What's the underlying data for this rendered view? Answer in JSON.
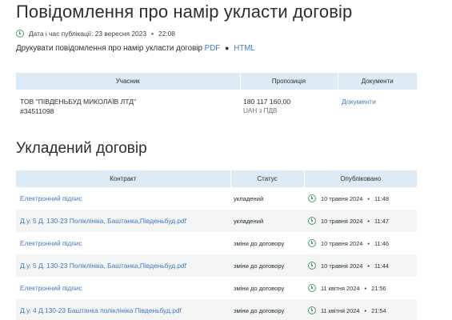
{
  "notice": {
    "title": "Повідомлення про намір укласти договір",
    "pub_label": "Дата і час публікації: 23 вересня 2023",
    "pub_time": "22:08",
    "print_label": "Друкувати повідомлення про намір укласти договір",
    "pdf_link": "PDF",
    "html_link": "HTML"
  },
  "participants_table": {
    "headers": [
      "Учасник",
      "Пропозиція",
      "Документи"
    ],
    "rows": [
      {
        "name": "ТОВ \"ПІВДЕНЬБУД МИКОЛАЇВ ЛТД\"",
        "code": "#34511098",
        "amount": "180 117 160,00",
        "currency": "UAH з ПДВ",
        "docs_link": "Документи"
      }
    ]
  },
  "contract": {
    "title": "Укладений договір",
    "headers": [
      "Контракт",
      "Статус",
      "Опубліковано"
    ],
    "rows": [
      {
        "name": "Електронний підпис",
        "status": "укладений",
        "date": "10 травня 2024",
        "time": "11:48"
      },
      {
        "name": "Д.у. 5 Д. 130-23 Поліклініка, Баштанка,Південьбуд.pdf",
        "status": "укладений",
        "date": "10 травня 2024",
        "time": "11:47"
      },
      {
        "name": "Електронний підпис",
        "status": "зміни до договору",
        "date": "10 травня 2024",
        "time": "11:46"
      },
      {
        "name": "Д.у. 5 Д. 130-23 Поліклініка, Баштанка,Південьбуд.pdf",
        "status": "зміни до договору",
        "date": "10 травня 2024",
        "time": "11:44"
      },
      {
        "name": "Електронний підпис",
        "status": "зміни до договору",
        "date": "11 квітня 2024",
        "time": "21:56"
      },
      {
        "name": "Д.у. 4 Д.130-23 Баштанка поліклініка Південьбуд.pdf",
        "status": "зміни до договору",
        "date": "11 квітня 2024",
        "time": "21:54"
      }
    ]
  },
  "colors": {
    "accent_link": "#3f7bc8",
    "header_bg": "#dcebf5",
    "clock_green": "#49a06a",
    "alt_row_bg": "#f2f5f3"
  }
}
